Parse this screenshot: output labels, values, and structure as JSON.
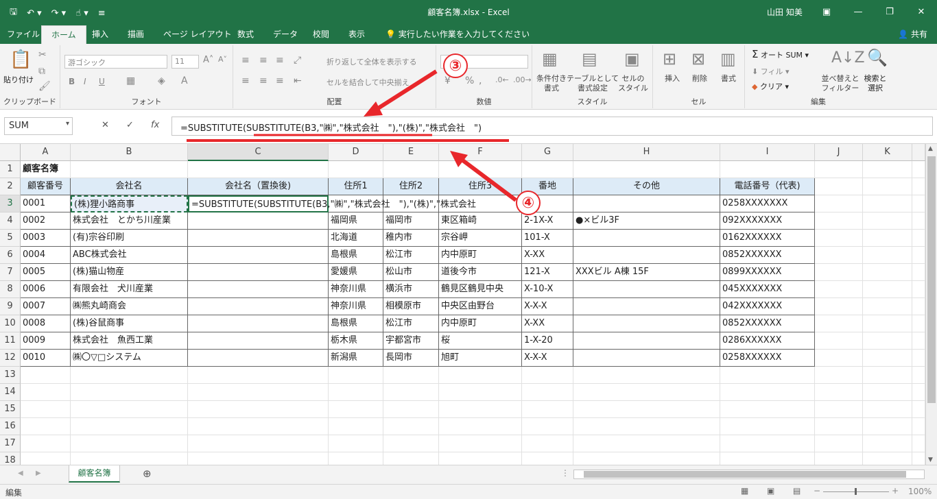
{
  "titlebar": {
    "title": "顧客名簿.xlsx  -  Excel",
    "user": "山田 知美"
  },
  "tabs": [
    "ファイル",
    "ホーム",
    "挿入",
    "描画",
    "ページ レイアウト",
    "数式",
    "データ",
    "校閲",
    "表示"
  ],
  "tellme": "実行したい作業を入力してください",
  "share": "共有",
  "ribbon": {
    "clipboard": "クリップボード",
    "paste": "貼り付け",
    "font": "フォント",
    "font_name": "游ゴシック",
    "font_size": "11",
    "alignment": "配置",
    "wrap": "折り返して全体を表示する",
    "merge": "セルを結合して中央揃え",
    "number": "数値",
    "styles": "スタイル",
    "cond": "条件付き\n書式",
    "table": "テーブルとして\n書式設定",
    "cellstyle": "セルの\nスタイル",
    "cells": "セル",
    "insert": "挿入",
    "delete": "削除",
    "format": "書式",
    "editing": "編集",
    "autosum": "オート SUM",
    "fill": "フィル",
    "clear": "クリア",
    "sort": "並べ替えと\nフィルター",
    "find": "検索と\n選択"
  },
  "namebox": "SUM",
  "formula": "=SUBSTITUTE(SUBSTITUTE(B3,\"㈱\",\"株式会社　\"),\"(株)\",\"株式会社　\")",
  "columns": [
    "A",
    "B",
    "C",
    "D",
    "E",
    "F",
    "G",
    "H",
    "I",
    "J",
    "K"
  ],
  "rows": [
    "1",
    "2",
    "3",
    "4",
    "5",
    "6",
    "7",
    "8",
    "9",
    "10",
    "11",
    "12",
    "13",
    "14",
    "15",
    "16",
    "17",
    "18"
  ],
  "sheet_title": "顧客名簿",
  "headers": [
    "顧客番号",
    "会社名",
    "会社名（置換後)",
    "住所1",
    "住所2",
    "住所3",
    "番地",
    "その他",
    "電話番号（代表)"
  ],
  "data": [
    [
      "0001",
      "(株)狸小路商事",
      "",
      "",
      "",
      "",
      "",
      "",
      "0258XXXXXXX"
    ],
    [
      "0002",
      "株式会社　とかち川産業",
      "",
      "福岡県",
      "福岡市",
      "東区箱崎",
      "2-1X-X",
      "●×ビル3F",
      "092XXXXXXX"
    ],
    [
      "0003",
      "(有)宗谷印刷",
      "",
      "北海道",
      "稚内市",
      "宗谷岬",
      "101-X",
      "",
      "0162XXXXXX"
    ],
    [
      "0004",
      "ABC株式会社",
      "",
      "島根県",
      "松江市",
      "内中原町",
      "X-XX",
      "",
      "0852XXXXXX"
    ],
    [
      "0005",
      "(株)猫山物産",
      "",
      "愛媛県",
      "松山市",
      "道後今市",
      "121-X",
      "XXXビル A棟 15F",
      "0899XXXXXX"
    ],
    [
      "0006",
      "有限会社　犬川産業",
      "",
      "神奈川県",
      "横浜市",
      "鶴見区鶴見中央",
      "X-10-X",
      "",
      "045XXXXXXX"
    ],
    [
      "0007",
      "㈱熊丸崎商会",
      "",
      "神奈川県",
      "相模原市",
      "中央区由野台",
      "X-X-X",
      "",
      "042XXXXXXX"
    ],
    [
      "0008",
      "(株)谷鼠商事",
      "",
      "島根県",
      "松江市",
      "内中原町",
      "X-XX",
      "",
      "0852XXXXXX"
    ],
    [
      "0009",
      "株式会社　魚西工業",
      "",
      "栃木県",
      "宇都宮市",
      "桜",
      "1-X-20",
      "",
      "0286XXXXXX"
    ],
    [
      "0010",
      "㈱〇▽□システム",
      "",
      "新潟県",
      "長岡市",
      "旭町",
      "X-X-X",
      "",
      "0258XXXXXX"
    ]
  ],
  "editing_cell": "=SUBSTITUTE(SUBSTITUTE(B3,\"㈱\",\"株式会社　\"),\"(株)\",\"株式会社",
  "sheet_tab": "顧客名簿",
  "status": {
    "mode": "編集",
    "zoom": "100%"
  },
  "badges": {
    "three": "③",
    "four": "④"
  }
}
